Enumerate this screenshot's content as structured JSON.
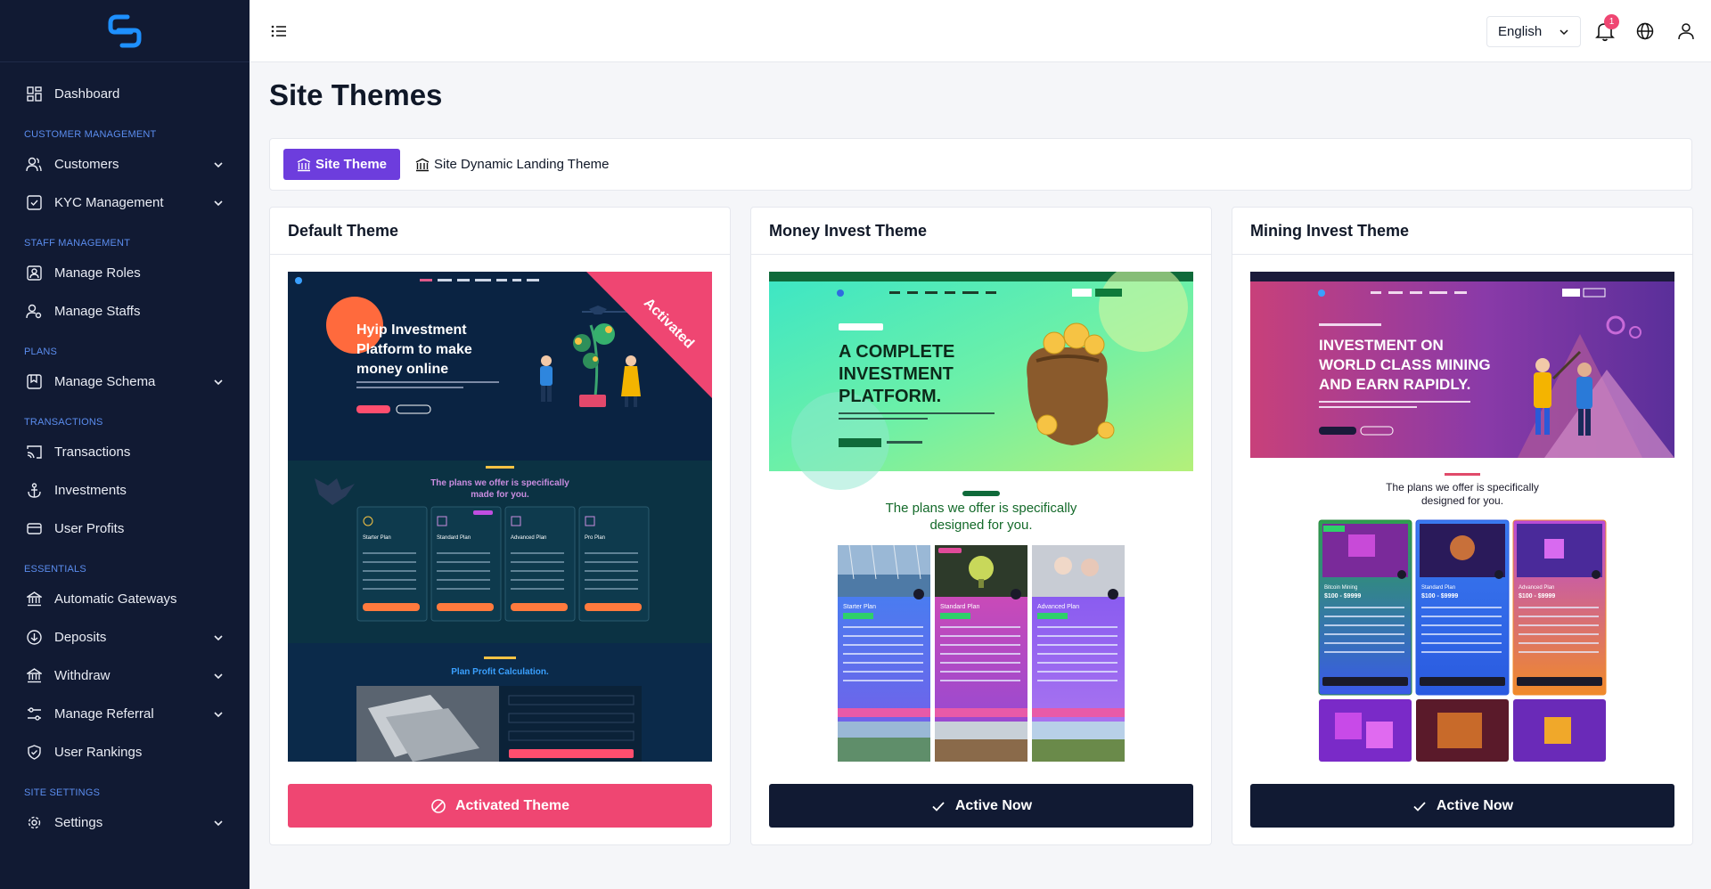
{
  "sidebar": {
    "items": [
      {
        "label": "Dashboard"
      },
      {
        "section": "CUSTOMER MANAGEMENT"
      },
      {
        "label": "Customers"
      },
      {
        "label": "KYC Management"
      },
      {
        "section": "STAFF MANAGEMENT"
      },
      {
        "label": "Manage Roles"
      },
      {
        "label": "Manage Staffs"
      },
      {
        "section": "PLANS"
      },
      {
        "label": "Manage Schema"
      },
      {
        "section": "TRANSACTIONS"
      },
      {
        "label": "Transactions"
      },
      {
        "label": "Investments"
      },
      {
        "label": "User Profits"
      },
      {
        "section": "ESSENTIALS"
      },
      {
        "label": "Automatic Gateways"
      },
      {
        "label": "Deposits"
      },
      {
        "label": "Withdraw"
      },
      {
        "label": "Manage Referral"
      },
      {
        "label": "User Rankings"
      },
      {
        "section": "SITE SETTINGS"
      },
      {
        "label": "Settings"
      }
    ]
  },
  "topbar": {
    "language": "English",
    "notification_count": "1"
  },
  "page": {
    "title": "Site Themes"
  },
  "tabs": {
    "site_theme": "Site Theme",
    "landing_theme": "Site Dynamic Landing Theme"
  },
  "themes": [
    {
      "name": "Default Theme",
      "button": "Activated Theme",
      "ribbon": "Activated",
      "preview": {
        "hero": [
          "Hyip Investment",
          "Platform to make",
          "money online"
        ],
        "plans_heading": [
          "The plans we offer is specifically",
          "made for you."
        ],
        "plans": [
          "Starter Plan",
          "Standard Plan",
          "Advanced Plan",
          "Pro Plan"
        ],
        "calc_heading": "Plan Profit Calculation."
      }
    },
    {
      "name": "Money Invest Theme",
      "button": "Active Now",
      "preview": {
        "hero": [
          "A COMPLETE",
          "INVESTMENT",
          "PLATFORM."
        ],
        "plans_heading": [
          "The plans we offer is specifically",
          "designed for you."
        ],
        "plans": [
          "Starter Plan",
          "Standard Plan",
          "Advanced Plan"
        ]
      }
    },
    {
      "name": "Mining Invest Theme",
      "button": "Active Now",
      "preview": {
        "hero": [
          "INVESTMENT ON",
          "WORLD CLASS MINING",
          "AND EARN RAPIDLY."
        ],
        "plans_heading": [
          "The plans we offer is specifically",
          "designed for you."
        ],
        "plans": [
          {
            "name": "Bitcoin Mining",
            "range": "$100 - $9999"
          },
          {
            "name": "Standard Plan",
            "range": "$100 - $9999"
          },
          {
            "name": "Advanced Plan",
            "range": "$100 - $9999"
          }
        ]
      }
    }
  ],
  "colors": {
    "sidebar": "#111a33",
    "accent": "#6d3ddd",
    "danger": "#ef4672",
    "section": "#5b8def"
  }
}
